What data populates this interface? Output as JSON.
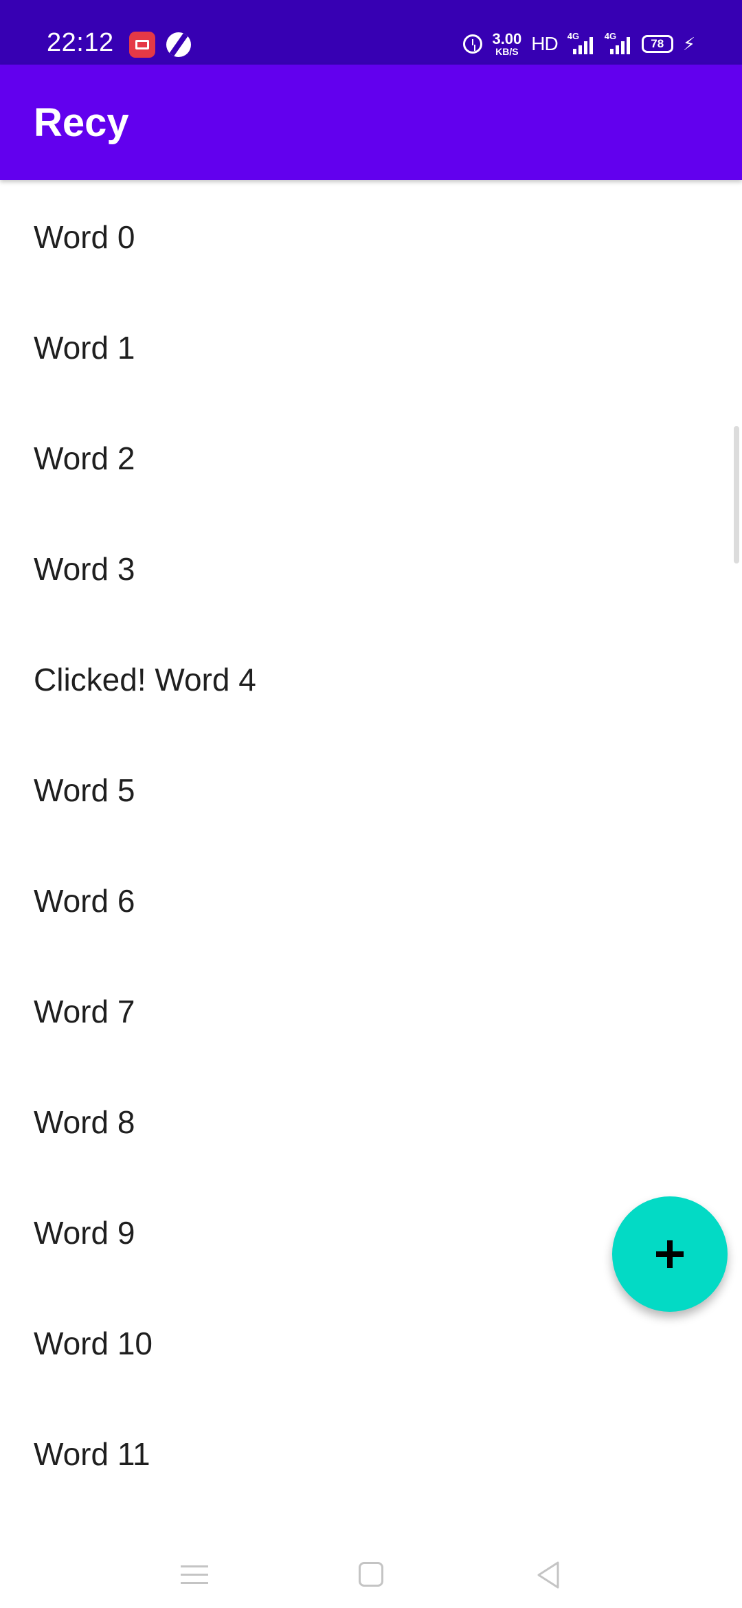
{
  "status_bar": {
    "time": "22:12",
    "net_speed_value": "3.00",
    "net_speed_unit": "KB/S",
    "hd_label": "HD",
    "signal1_tag": "4G",
    "signal2_tag": "4G",
    "battery_level": "78",
    "icons": [
      "screen-record-icon",
      "globe-icon",
      "alarm-icon",
      "signal-icon",
      "battery-icon",
      "charging-bolt-icon"
    ]
  },
  "app_bar": {
    "title": "Recy"
  },
  "list": {
    "items": [
      "Word 0",
      "Word 1",
      "Word 2",
      "Word 3",
      "Clicked! Word 4",
      "Word 5",
      "Word 6",
      "Word 7",
      "Word 8",
      "Word 9",
      "Word 10",
      "Word 11"
    ]
  },
  "fab": {
    "icon": "plus-icon"
  },
  "nav_bar": {
    "icons": [
      "menu-icon",
      "home-icon",
      "back-icon"
    ]
  },
  "colors": {
    "status_bar": "#3700B3",
    "app_bar": "#6200EE",
    "fab": "#03DAC5",
    "text": "#1f1f1f"
  }
}
